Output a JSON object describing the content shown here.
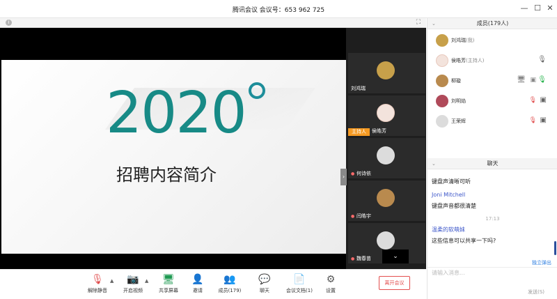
{
  "window": {
    "title": "腾讯会议  会议号：653 962 725",
    "minimize_glyph": "—",
    "maximize_glyph": "☐",
    "close_glyph": "✕"
  },
  "stage": {
    "info_glyph": "i",
    "fullscreen_glyph": "⛶",
    "slide": {
      "year": "2020",
      "subtitle": "招聘内容简介"
    },
    "slide_nav_glyph": "›"
  },
  "video_strip": {
    "tiles": [
      {
        "name": "刘鸿瑞",
        "avatar_color": "#c7a04a"
      },
      {
        "name": "侯皓芳",
        "host_badge": "主持人",
        "avatar_color": "#f3e3dc"
      },
      {
        "name": "何诗依",
        "avatar_color": "#dcdcdc"
      },
      {
        "name": "闫皓宇",
        "avatar_color": "#b98a4e"
      },
      {
        "name": "魏春苗",
        "avatar_color": "#dcdcdc"
      }
    ],
    "collapse_glyph": "⌄"
  },
  "toolbar": {
    "items": [
      {
        "label": "解除静音",
        "icon": "mic-muted-icon",
        "glyph": "🎙"
      },
      {
        "label": "开启视频",
        "icon": "camera-off-icon",
        "glyph": "📷"
      },
      {
        "label": "共享屏幕",
        "icon": "share-screen-icon",
        "glyph": "🖥"
      },
      {
        "label": "邀请",
        "icon": "invite-icon",
        "glyph": "👤"
      },
      {
        "label": "成员(179)",
        "icon": "members-icon",
        "glyph": "👥"
      },
      {
        "label": "聊天",
        "icon": "chat-icon",
        "glyph": "💬"
      },
      {
        "label": "会议文档(1)",
        "icon": "document-icon",
        "glyph": "📄"
      },
      {
        "label": "设置",
        "icon": "settings-icon",
        "glyph": "⚙"
      }
    ],
    "caret_glyph": "▲",
    "leave_label": "离开会议"
  },
  "members": {
    "header": "成员(179人)",
    "collapse_glyph": "⌄",
    "list": [
      {
        "name": "刘鸿瑞",
        "role": "(我)",
        "avatar_color": "#c7a04a"
      },
      {
        "name": "侯皓芳",
        "role": "(主持人)",
        "avatar_color": "#f3e3dc"
      },
      {
        "name": "柳璇",
        "role": "",
        "avatar_color": "#b98a4e"
      },
      {
        "name": "刘明焰",
        "role": "",
        "avatar_color": "#b04a5a"
      },
      {
        "name": "王荣辉",
        "role": "",
        "avatar_color": "#dcdcdc"
      }
    ]
  },
  "chat": {
    "header": "聊天",
    "messages": [
      {
        "name": "",
        "text": "键盘声清晰可听"
      },
      {
        "name": "Joni Mitchell",
        "text": "键盘声音都很清楚"
      },
      {
        "time": "17:13"
      },
      {
        "name": "温柔的软萌妹",
        "text": "这些信息可以共享一下吗?"
      }
    ],
    "popout_label": "独立弹出",
    "input_placeholder": "请输入消息...",
    "send_label": "发送(S)"
  },
  "colors": {
    "accent_teal": "#178a86",
    "leave_red": "#e34d4d",
    "chat_name_blue": "#3b55c9",
    "host_badge_orange": "#f59a23"
  }
}
